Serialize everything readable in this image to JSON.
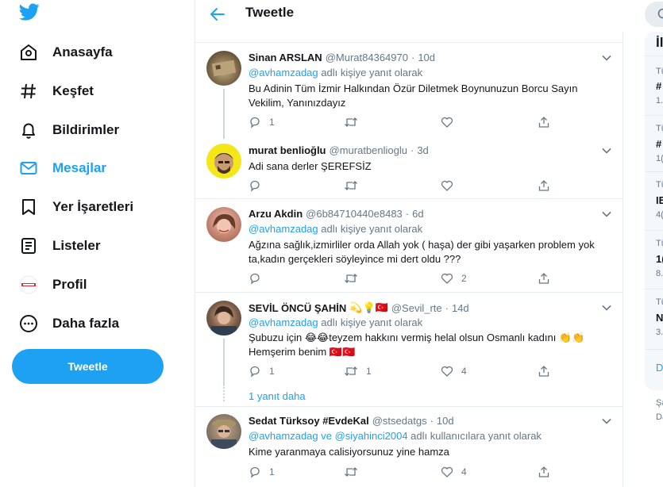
{
  "nav": {
    "items": [
      {
        "label": "Anasayfa",
        "icon": "home-icon"
      },
      {
        "label": "Keşfet",
        "icon": "hashtag-icon"
      },
      {
        "label": "Bildirimler",
        "icon": "bell-icon"
      },
      {
        "label": "Mesajlar",
        "icon": "mail-icon"
      },
      {
        "label": "Yer İşaretleri",
        "icon": "bookmark-icon"
      },
      {
        "label": "Listeler",
        "icon": "list-icon"
      },
      {
        "label": "Profil",
        "icon": "profile-avatar-icon"
      },
      {
        "label": "Daha fazla",
        "icon": "more-circle-icon"
      }
    ],
    "tweet_button": "Tweetle",
    "accent": "#1da1f2"
  },
  "header": {
    "title": "Tweetle"
  },
  "tweets": [
    {
      "name": "Sinan ARSLAN",
      "handle": "@Murat84364970",
      "time": "10d",
      "reply_prefix": "@avhamzadag",
      "reply_suffix": " adlı kişiye yanıt olarak",
      "text": "Bu Adinin Tüm İzmir Halkından Özür Diletmek Boynunuzun Borcu Sayın Vekilim, Yanınızdayız",
      "replies": "1",
      "retweets": "",
      "likes": ""
    },
    {
      "name": "murat benlioğlu",
      "handle": "@muratbenlioglu",
      "time": "3d",
      "text": "Adi sana derler ŞEREFSİZ",
      "replies": "",
      "retweets": "",
      "likes": ""
    },
    {
      "name": "Arzu Akdin",
      "handle": "@6b84710440e8483",
      "time": "6d",
      "reply_prefix": "@avhamzadag",
      "reply_suffix": " adlı kişiye yanıt olarak",
      "text": "Ağzına sağlık,izmirliler orda Allah yok ( haşa) der gibi yaşarken problem yok ta,kadın gerçekleri söyleyince mi dert oldu ???",
      "replies": "",
      "retweets": "",
      "likes": "2"
    },
    {
      "name": "SEVİL ÖNCÜ ŞAHİN",
      "name_emoji": "💫💡🇹🇷",
      "handle": "@Sevil_rte",
      "time": "14d",
      "reply_prefix": "@avhamzadag",
      "reply_suffix": " adlı kişiye yanıt olarak",
      "text_line1": "Şubuzu için 😂😂teyzem hakkını vermiş helal olsun Osmanlı kadını 👏👏",
      "text_line2": "Hemşerim benim 🇹🇷🇹🇷",
      "replies": "1",
      "retweets": "1",
      "likes": "4",
      "more_replies": "1 yanıt daha"
    },
    {
      "name": "Sedat Türksoy #EvdeKal",
      "handle": "@stsedatgs",
      "time": "10d",
      "reply_prefix": "@avhamzadag ve @siyahinci2004",
      "reply_suffix": " adlı kullanıcılara yanıt olarak",
      "text": "Kime yaranmaya calisiyorsunuz yine hamza",
      "replies": "1",
      "retweets": "",
      "likes": "4"
    }
  ],
  "right": {
    "heading": "İl",
    "rows": [
      {
        "line1": "Tü",
        "line2": "#",
        "line3": "1."
      },
      {
        "line1": "Tü",
        "line2": "#",
        "line3": "1("
      },
      {
        "line1": "Tü",
        "line2": "IE",
        "line3": "4("
      },
      {
        "line1": "Tü",
        "line2": "1(",
        "line3": "8."
      },
      {
        "line1": "Tü",
        "line2": "N",
        "line3": "3."
      }
    ],
    "more": "D",
    "footer1": "Şa",
    "footer2": "Da"
  }
}
